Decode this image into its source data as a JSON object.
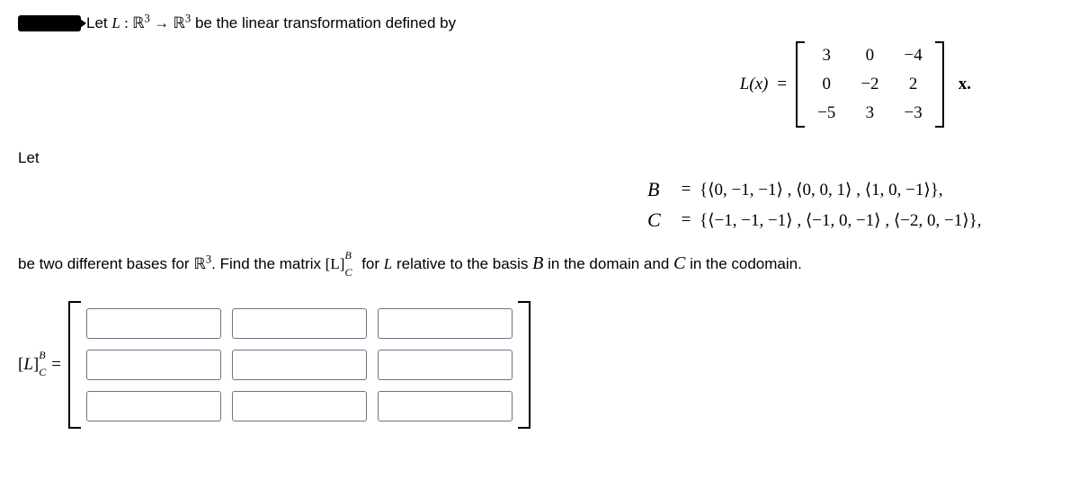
{
  "problem": {
    "intro_prefix": "Let ",
    "L_symbol": "L",
    "colon": " : ",
    "R": "ℝ",
    "exp3": "3",
    "arrow": " → ",
    "intro_suffix": " be the linear transformation defined by",
    "Lx": "L(x)",
    "equals": "=",
    "matrix": {
      "r1": {
        "c1": "3",
        "c2": "0",
        "c3": "−4"
      },
      "r2": {
        "c1": "0",
        "c2": "−2",
        "c3": "2"
      },
      "r3": {
        "c1": "−5",
        "c2": "3",
        "c3": "−3"
      }
    },
    "x_suffix": "x.",
    "let2": "Let",
    "basisB_label": "B",
    "basisC_label": "C",
    "basisB_set": "{⟨0, −1, −1⟩ , ⟨0, 0, 1⟩ , ⟨1, 0, −1⟩},",
    "basisC_set": "{⟨−1, −1, −1⟩ , ⟨−1, 0, −1⟩ , ⟨−2, 0, −1⟩},",
    "instr_part1": "be two different bases for ",
    "instr_part2": ". Find the matrix ",
    "LBC": "[L]",
    "LBC_sup": "B",
    "LBC_sub": "C",
    "instr_part3": " for ",
    "instr_part4": " relative to the basis ",
    "instr_part5": " in the domain and ",
    "instr_part6": " in the codomain.",
    "answer_lhs_open": "[",
    "answer_lhs_L": "L",
    "answer_lhs_close": "]",
    "answer_eq": " ="
  }
}
